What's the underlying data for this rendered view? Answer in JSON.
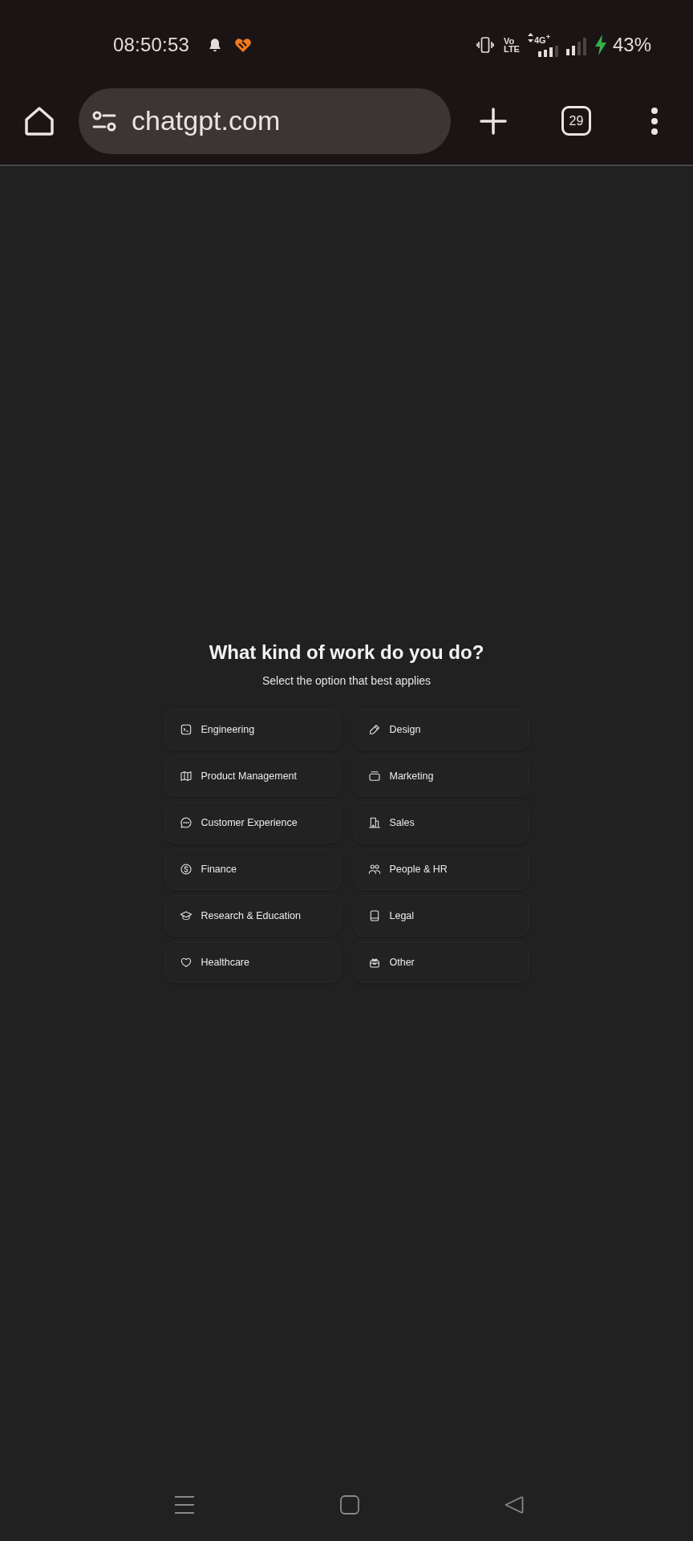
{
  "status_bar": {
    "time": "08:50:53",
    "volte_top": "Vo",
    "volte_bottom": "LTE",
    "network_type": "4G$^{+}$",
    "battery": "43%"
  },
  "browser": {
    "url": "chatgpt.com",
    "tab_count": "29"
  },
  "onboarding": {
    "title": "What kind of work do you do?",
    "subtitle": "Select the option that best applies",
    "options": [
      {
        "label": "Engineering"
      },
      {
        "label": "Design"
      },
      {
        "label": "Product Management"
      },
      {
        "label": "Marketing"
      },
      {
        "label": "Customer Experience"
      },
      {
        "label": "Sales"
      },
      {
        "label": "Finance"
      },
      {
        "label": "People & HR"
      },
      {
        "label": "Research & Education"
      },
      {
        "label": "Legal"
      },
      {
        "label": "Healthcare"
      },
      {
        "label": "Other"
      }
    ]
  }
}
